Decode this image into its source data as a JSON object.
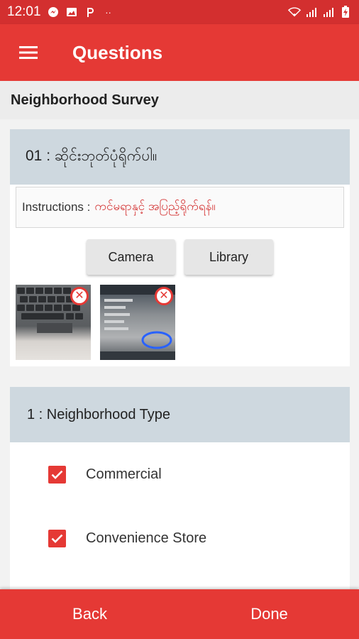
{
  "status_bar": {
    "time": "12:01",
    "notification_icons": [
      "messenger-icon",
      "image-icon",
      "p-app-icon",
      "more-dots-icon"
    ],
    "status_icons": [
      "wifi-icon",
      "signal-icon",
      "signal-icon",
      "battery-charging-icon"
    ],
    "overflow_glyph": "··"
  },
  "app_bar": {
    "title": "Questions",
    "menu_icon": "hamburger-menu-icon"
  },
  "survey": {
    "title": "Neighborhood Survey"
  },
  "question1": {
    "header": "01 : ဆိုင်းဘုတ်ပုံရိုက်ပါ။",
    "instructions_label": "Instructions :",
    "instructions_value": "ကင်မရာနှင့် အပြည့်ရိုက်ရန်။",
    "camera_button": "Camera",
    "library_button": "Library",
    "photos": [
      {
        "name": "keyboard-photo",
        "remove_icon": "close-circle-icon"
      },
      {
        "name": "screen-photo",
        "remove_icon": "close-circle-icon"
      }
    ]
  },
  "question2": {
    "header": "1 : Neighborhood Type",
    "options": [
      {
        "label": "Commercial",
        "checked": true
      },
      {
        "label": "Convenience Store",
        "checked": true
      }
    ]
  },
  "bottom_bar": {
    "back_label": "Back",
    "done_label": "Done"
  },
  "colors": {
    "primary": "#e53935",
    "status_bar": "#d32f2f",
    "question_header": "#ced8df",
    "instruction_text": "#d32f2f"
  }
}
